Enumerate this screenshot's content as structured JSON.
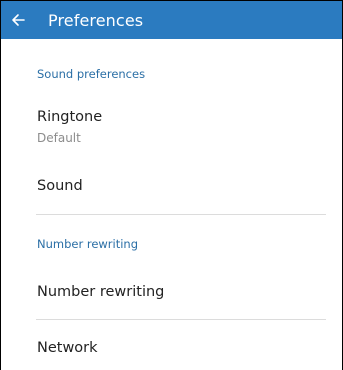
{
  "app_bar": {
    "title": "Preferences",
    "background_color": "#2b7bc0",
    "back_icon": "arrow-back-icon"
  },
  "sections": [
    {
      "header": "Sound preferences",
      "items": [
        {
          "title": "Ringtone",
          "summary": "Default"
        },
        {
          "title": "Sound"
        }
      ]
    },
    {
      "header": "Number rewriting",
      "items": [
        {
          "title": "Number rewriting"
        }
      ]
    },
    {
      "items": [
        {
          "title": "Network"
        }
      ]
    }
  ],
  "colors": {
    "accent": "#2b6fa6",
    "divider": "#dcdcdc"
  }
}
